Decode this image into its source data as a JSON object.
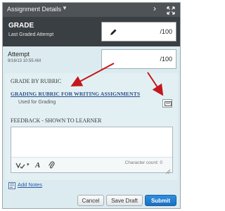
{
  "header": {
    "title": "Assignment Details"
  },
  "grade": {
    "label": "GRADE",
    "sublabel": "Last Graded Attempt",
    "denominator": "/100"
  },
  "attempt": {
    "label": "Attempt",
    "date": "9/16/13 10:55 AM",
    "denominator": "/100"
  },
  "rubric": {
    "heading": "GRADE BY RUBRIC",
    "link": "GRADING RUBRIC FOR WRITING ASSIGNMENTS",
    "used_for": "Used for Grading"
  },
  "feedback": {
    "heading": "FEEDBACK - SHOWN TO LEARNER",
    "char_count": "Character count: 0"
  },
  "notes": {
    "label": "Add Notes"
  },
  "actions": {
    "cancel": "Cancel",
    "save_draft": "Save Draft",
    "submit": "Submit"
  },
  "colors": {
    "header_bg": "#4e5358",
    "grade_bg": "#3a3f44",
    "panel_bg": "#dcebef",
    "link": "#2a4e8a",
    "submit": "#1b6fbf",
    "annotation_arrow": "#c4161c"
  },
  "icons": {
    "header_menu": "chevron-down-icon",
    "header_next": "chevron-right-icon",
    "header_expand": "expand-icon",
    "grade_edit": "pencil-icon",
    "rubric_view": "rubric-view-icon",
    "spellcheck": "spellcheck-icon",
    "format": "text-format-icon",
    "attach": "paperclip-icon",
    "notes": "notes-icon"
  }
}
